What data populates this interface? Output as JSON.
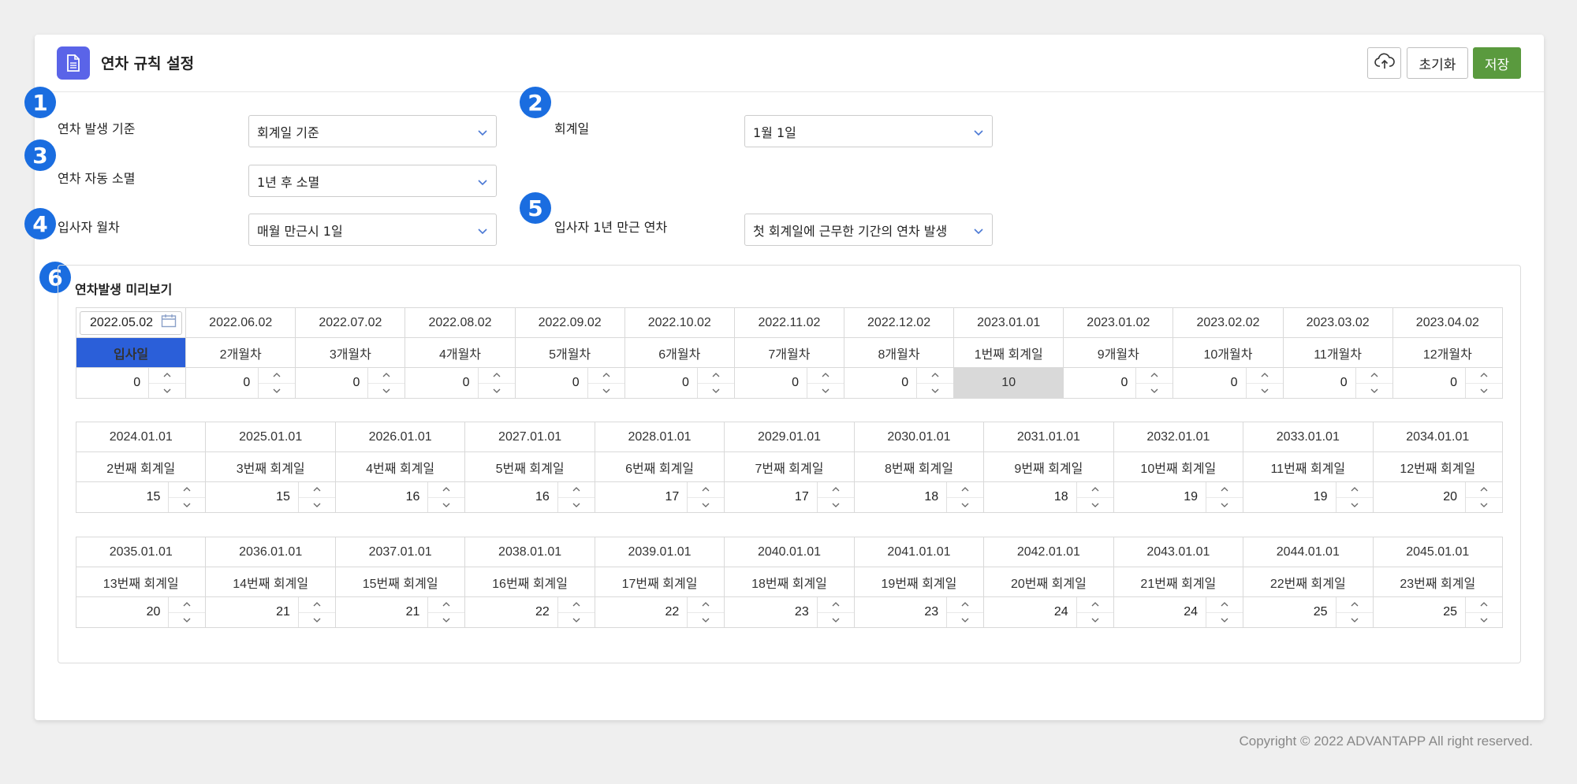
{
  "header": {
    "title": "연차 규칙 설정",
    "reset_label": "초기화",
    "save_label": "저장"
  },
  "badges": [
    "1",
    "2",
    "3",
    "4",
    "5",
    "6"
  ],
  "fields": {
    "basis": {
      "label": "연차 발생 기준",
      "value": "회계일 기준"
    },
    "fiscal_day": {
      "label": "회계일",
      "value": "1월 1일"
    },
    "expiry": {
      "label": "연차 자동 소멸",
      "value": "1년 후 소멸"
    },
    "monthly": {
      "label": "입사자 월차",
      "value": "매월 만근시 1일"
    },
    "first_year": {
      "label": "입사자 1년 만근 연차",
      "value": "첫 회계일에 근무한 기간의 연차 발생"
    }
  },
  "preview": {
    "title": "연차발생 미리보기",
    "row1": {
      "dates": [
        "2022.05.02",
        "2022.06.02",
        "2022.07.02",
        "2022.08.02",
        "2022.09.02",
        "2022.10.02",
        "2022.11.02",
        "2022.12.02",
        "2023.01.01",
        "2023.01.02",
        "2023.02.02",
        "2023.03.02",
        "2023.04.02"
      ],
      "labels": [
        "입사일",
        "2개월차",
        "3개월차",
        "4개월차",
        "5개월차",
        "6개월차",
        "7개월차",
        "8개월차",
        "1번째 회계일",
        "9개월차",
        "10개월차",
        "11개월차",
        "12개월차"
      ],
      "values": [
        "0",
        "0",
        "0",
        "0",
        "0",
        "0",
        "0",
        "0",
        "10",
        "0",
        "0",
        "0",
        "0"
      ]
    },
    "row2": {
      "dates": [
        "2024.01.01",
        "2025.01.01",
        "2026.01.01",
        "2027.01.01",
        "2028.01.01",
        "2029.01.01",
        "2030.01.01",
        "2031.01.01",
        "2032.01.01",
        "2033.01.01",
        "2034.01.01"
      ],
      "labels": [
        "2번째 회계일",
        "3번째 회계일",
        "4번째 회계일",
        "5번째 회계일",
        "6번째 회계일",
        "7번째 회계일",
        "8번째 회계일",
        "9번째 회계일",
        "10번째 회계일",
        "11번째 회계일",
        "12번째 회계일"
      ],
      "values": [
        "15",
        "15",
        "16",
        "16",
        "17",
        "17",
        "18",
        "18",
        "19",
        "19",
        "20"
      ]
    },
    "row3": {
      "dates": [
        "2035.01.01",
        "2036.01.01",
        "2037.01.01",
        "2038.01.01",
        "2039.01.01",
        "2040.01.01",
        "2041.01.01",
        "2042.01.01",
        "2043.01.01",
        "2044.01.01",
        "2045.01.01"
      ],
      "labels": [
        "13번째 회계일",
        "14번째 회계일",
        "15번째 회계일",
        "16번째 회계일",
        "17번째 회계일",
        "18번째 회계일",
        "19번째 회계일",
        "20번째 회계일",
        "21번째 회계일",
        "22번째 회계일",
        "23번째 회계일"
      ],
      "values": [
        "20",
        "21",
        "21",
        "22",
        "22",
        "23",
        "23",
        "24",
        "24",
        "25",
        "25"
      ]
    }
  },
  "footer": {
    "copyright": "Copyright © 2022 ADVANTAPP All right reserved."
  },
  "colors": {
    "accent": "#1a6de0",
    "save": "#5a9a3e",
    "hired": "#2b5fd9",
    "doc_badge": "#5a64e8"
  },
  "icons": [
    "document-icon",
    "cloud-upload-icon",
    "chevron-down-icon",
    "calendar-icon",
    "spin-up-icon",
    "spin-down-icon"
  ]
}
